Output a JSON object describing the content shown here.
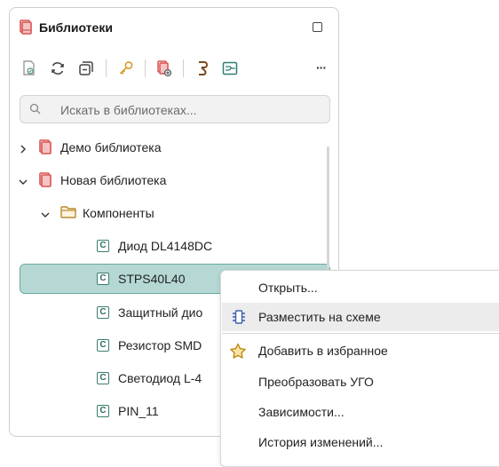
{
  "panel": {
    "title": "Библиотеки"
  },
  "search": {
    "placeholder": "Искать в библиотеках..."
  },
  "tree": [
    {
      "label": "Демо библиотека",
      "type": "library",
      "expanded": false
    },
    {
      "label": "Новая библиотека",
      "type": "library",
      "expanded": true
    },
    {
      "label": "Компоненты",
      "type": "folder",
      "expanded": true
    },
    {
      "label": "Диод DL4148DC",
      "type": "component"
    },
    {
      "label": "STPS40L40",
      "type": "component",
      "selected": true
    },
    {
      "label": "Защитный дио",
      "type": "component"
    },
    {
      "label": "Резистор SMD",
      "type": "component"
    },
    {
      "label": "Светодиод L-4",
      "type": "component"
    },
    {
      "label": "PIN_11",
      "type": "component"
    }
  ],
  "component_icon_letter": "C",
  "context_menu": {
    "items": [
      {
        "label": "Открыть...",
        "icon": ""
      },
      {
        "label": "Разместить на схеме",
        "icon": "place-on-schematic-icon",
        "highlighted": true
      },
      {
        "label": "Добавить в избранное",
        "icon": "star-icon"
      },
      {
        "label": "Преобразовать УГО",
        "icon": ""
      },
      {
        "label": "Зависимости...",
        "icon": ""
      },
      {
        "label": "История изменений...",
        "icon": ""
      }
    ]
  },
  "colors": {
    "selection_bg": "#b5d8d4",
    "selection_border": "#6aa9a3",
    "library_icon": "#d9534f",
    "component_icon": "#3b7c6f"
  }
}
